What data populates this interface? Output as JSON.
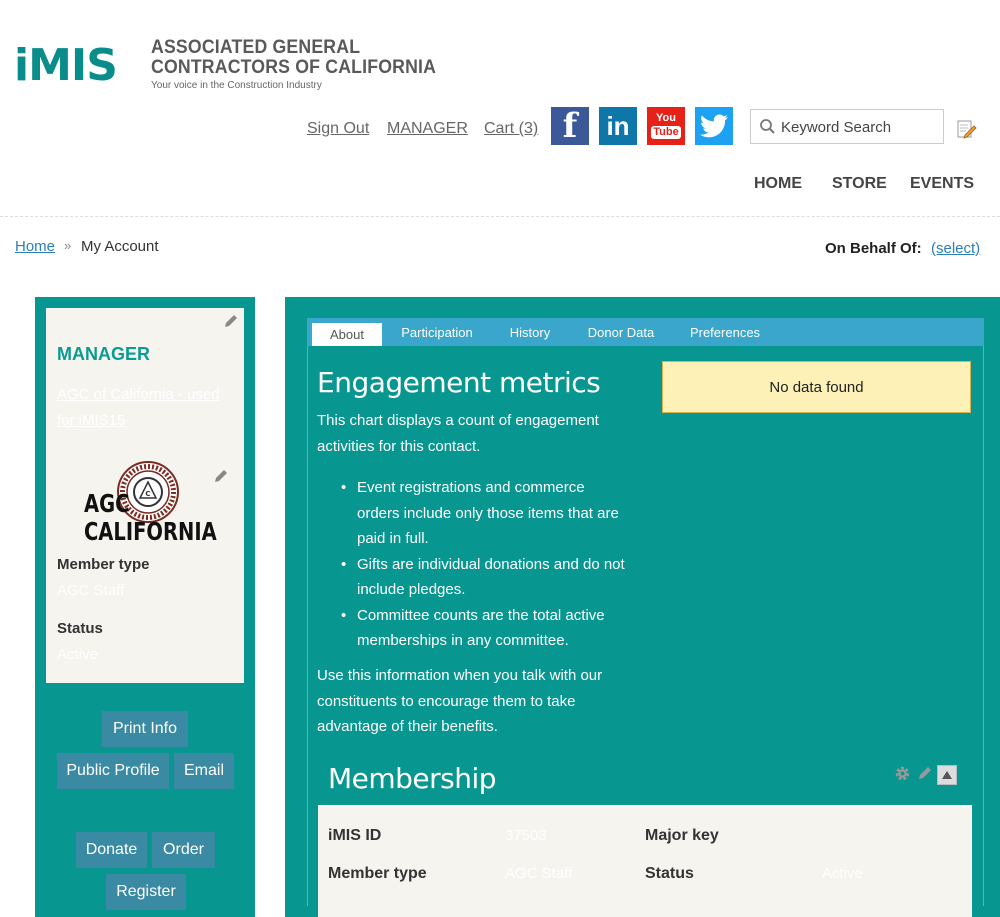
{
  "brand": {
    "logo_text": "iMIS",
    "org_line1": "ASSOCIATED GENERAL",
    "org_line2": "CONTRACTORS OF CALIFORNIA",
    "tagline": "Your voice in the Construction Industry"
  },
  "header": {
    "sign_out": "Sign Out",
    "user": "MANAGER",
    "cart": "Cart (3)",
    "social": {
      "facebook": "f",
      "linkedin": "in",
      "youtube_top": "You",
      "youtube_bottom": "Tube"
    },
    "search_placeholder": "Keyword Search",
    "nav": [
      "HOME",
      "STORE",
      "EVENTS"
    ]
  },
  "breadcrumb": {
    "home": "Home",
    "separator": "»",
    "current": "My Account",
    "behalf_label": "On Behalf Of:",
    "behalf_select": "(select)"
  },
  "profile": {
    "role": "MANAGER",
    "organization": "AGC of California - used for iMIS15",
    "logo_text_top": "AGC",
    "logo_text_bottom": "CALIFORNIA",
    "member_type_label": "Member type",
    "member_type_value": "AGC Staff",
    "status_label": "Status",
    "status_value": "Active",
    "buttons": {
      "print_info": "Print Info",
      "public_profile": "Public Profile",
      "email": "Email",
      "donate": "Donate",
      "order": "Order",
      "register": "Register"
    }
  },
  "tabs": [
    "About",
    "Participation",
    "History",
    "Donor Data",
    "Preferences"
  ],
  "engagement": {
    "heading": "Engagement metrics",
    "intro": "This chart displays a count of engagement activities for this contact.",
    "bullets": [
      "Event registrations and commerce orders include only those items that are paid in full.",
      "Gifts are individual donations and do not include pledges.",
      "Committee counts are the total active memberships in any committee."
    ],
    "outro": "Use this information when you talk with our constituents to encourage them to take advantage of their benefits.",
    "no_data": "No data found"
  },
  "membership": {
    "heading": "Membership",
    "imis_id_label": "iMIS ID",
    "imis_id_value": "37503",
    "major_key_label": "Major key",
    "member_type_label": "Member type",
    "member_type_value": "AGC Staff",
    "status_label": "Status",
    "status_value": "Active"
  },
  "colors": {
    "teal": "#079690",
    "tab_blue": "#3aa6cc",
    "button_blue": "#3a8aa4",
    "card_bg": "#f5f4ef",
    "notice_bg": "#fdf1b8"
  }
}
